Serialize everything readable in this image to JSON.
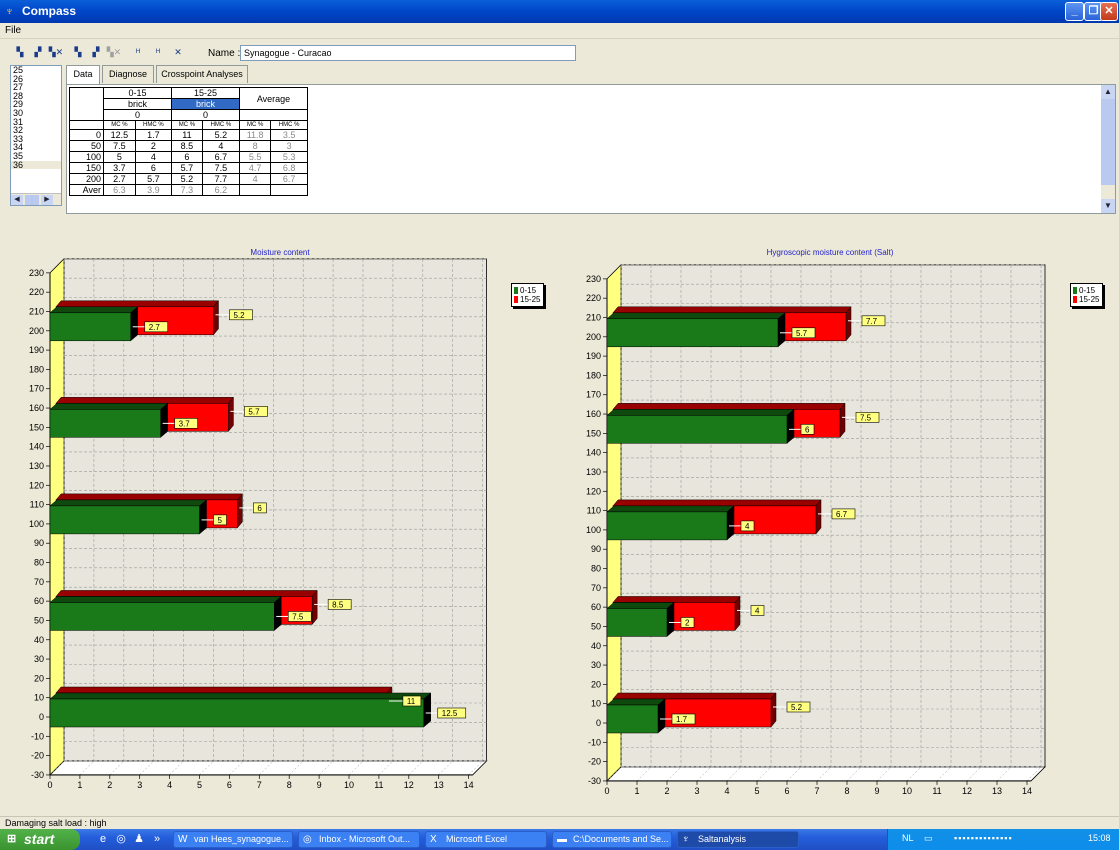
{
  "window": {
    "title": "Compass",
    "icon": "compass-app-icon",
    "controls": [
      "minimize-icon",
      "maximize-icon",
      "close-icon"
    ]
  },
  "menu": {
    "file": "File"
  },
  "toolbar": {
    "name_label": "Name :",
    "name_value": "Synagogue - Curacao"
  },
  "sidelist": {
    "items": [
      "25",
      "26",
      "27",
      "28",
      "29",
      "30",
      "31",
      "32",
      "33",
      "34",
      "35",
      "36"
    ],
    "selected": "36"
  },
  "tabs": [
    "Data",
    "Diagnose",
    "Crosspoint Analyses"
  ],
  "grid": {
    "groups": [
      {
        "range": "0-15",
        "material": "brick",
        "salt": "0"
      },
      {
        "range": "15-25",
        "material": "brick",
        "salt": "0"
      }
    ],
    "average_label": "Average",
    "sub_headers": [
      "MC %",
      "HMC %",
      "MC %",
      "HMC %",
      "MC %",
      "HMC %"
    ],
    "rows": [
      {
        "depth": "0",
        "cells": [
          "12.5",
          "1.7",
          "11",
          "5.2",
          "11.8",
          "3.5"
        ]
      },
      {
        "depth": "50",
        "cells": [
          "7.5",
          "2",
          "8.5",
          "4",
          "8",
          "3"
        ]
      },
      {
        "depth": "100",
        "cells": [
          "5",
          "4",
          "6",
          "6.7",
          "5.5",
          "5.3"
        ]
      },
      {
        "depth": "150",
        "cells": [
          "3.7",
          "6",
          "5.7",
          "7.5",
          "4.7",
          "6.8"
        ]
      },
      {
        "depth": "200",
        "cells": [
          "2.7",
          "5.7",
          "5.2",
          "7.7",
          "4",
          "6.7"
        ]
      },
      {
        "depth": "Aver",
        "cells": [
          "6.3",
          "3.9",
          "7.3",
          "6.2",
          "",
          ""
        ]
      }
    ]
  },
  "chart_data": [
    {
      "type": "bar",
      "orientation": "horizontal",
      "title": "Moisture content",
      "categories": [
        0,
        50,
        100,
        150,
        200
      ],
      "series": [
        {
          "name": "0-15",
          "color": "#1A7A1A",
          "values": [
            12.5,
            7.5,
            5,
            3.7,
            2.7
          ]
        },
        {
          "name": "15-25",
          "color": "#FF0000",
          "values": [
            11,
            8.5,
            6,
            5.7,
            5.2
          ]
        }
      ],
      "y_ticks": [
        -30,
        -20,
        -10,
        0,
        10,
        20,
        30,
        40,
        50,
        60,
        70,
        80,
        90,
        100,
        110,
        120,
        130,
        140,
        150,
        160,
        170,
        180,
        190,
        200,
        210,
        220,
        230
      ],
      "x_ticks": [
        0,
        1,
        2,
        3,
        4,
        5,
        6,
        7,
        8,
        9,
        10,
        11,
        12,
        13,
        14
      ],
      "ylim": [
        -30,
        230
      ],
      "xlim": [
        0,
        14
      ],
      "grid": true,
      "legend": "top-right"
    },
    {
      "type": "bar",
      "orientation": "horizontal",
      "title": "Hygroscopic moisture content (Salt)",
      "categories": [
        0,
        50,
        100,
        150,
        200
      ],
      "series": [
        {
          "name": "0-15",
          "color": "#1A7A1A",
          "values": [
            1.7,
            2,
            4,
            6,
            5.7
          ]
        },
        {
          "name": "15-25",
          "color": "#FF0000",
          "values": [
            5.2,
            4,
            6.7,
            7.5,
            7.7
          ]
        }
      ],
      "y_ticks": [
        -30,
        -20,
        -10,
        0,
        10,
        20,
        30,
        40,
        50,
        60,
        70,
        80,
        90,
        100,
        110,
        120,
        130,
        140,
        150,
        160,
        170,
        180,
        190,
        200,
        210,
        220,
        230
      ],
      "x_ticks": [
        0,
        1,
        2,
        3,
        4,
        5,
        6,
        7,
        8,
        9,
        10,
        11,
        12,
        13,
        14
      ],
      "ylim": [
        -30,
        230
      ],
      "xlim": [
        0,
        14
      ],
      "grid": true,
      "legend": "top-right"
    }
  ],
  "status": {
    "text": "Damaging salt load : high"
  },
  "taskbar": {
    "start": "start",
    "tasks": [
      {
        "label": "van Hees_synagogue...",
        "icon": "word-icon"
      },
      {
        "label": "Inbox - Microsoft Out...",
        "icon": "outlook-icon"
      },
      {
        "label": "Microsoft Excel",
        "icon": "excel-icon"
      },
      {
        "label": "C:\\Documents and Se...",
        "icon": "folder-icon"
      },
      {
        "label": "Saltanalysis",
        "icon": "compass-app-icon"
      }
    ],
    "tray_lang": "NL",
    "clock": "15:08"
  }
}
